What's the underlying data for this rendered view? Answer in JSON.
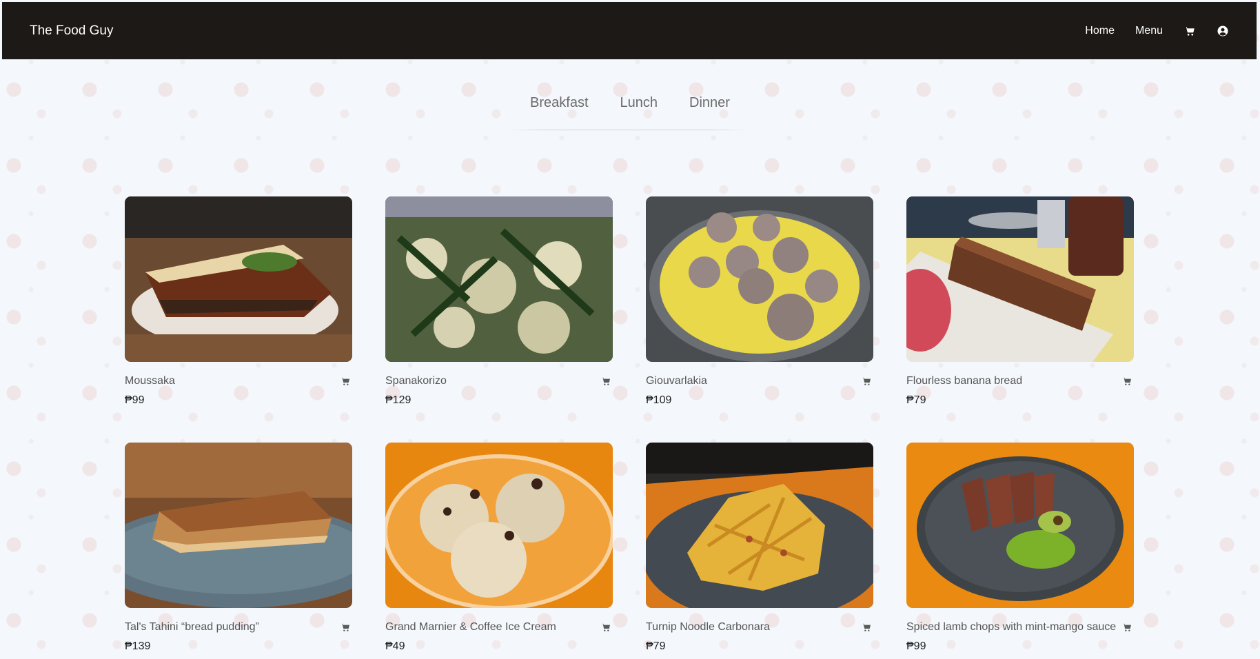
{
  "navbar": {
    "brand": "The Food Guy",
    "links": [
      "Home",
      "Menu"
    ],
    "icons": [
      "cart-icon",
      "user-circle-icon"
    ]
  },
  "tabs": [
    "Breakfast",
    "Lunch",
    "Dinner"
  ],
  "products": [
    {
      "name": "Moussaka",
      "price": "₱99"
    },
    {
      "name": "Spanakorizo",
      "price": "₱129"
    },
    {
      "name": "Giouvarlakia",
      "price": "₱109"
    },
    {
      "name": "Flourless banana bread",
      "price": "₱79"
    },
    {
      "name": "Tal's Tahini “bread pudding”",
      "price": "₱139"
    },
    {
      "name": "Grand Marnier & Coffee Ice Cream",
      "price": "₱49"
    },
    {
      "name": "Turnip Noodle Carbonara",
      "price": "₱79"
    },
    {
      "name": "Spiced lamb chops with mint-mango sauce",
      "price": "₱99"
    }
  ],
  "colors": {
    "navbar_bg": "#1c1917",
    "page_bg": "#f4f7fb",
    "tab_text": "#6b6b6b"
  }
}
